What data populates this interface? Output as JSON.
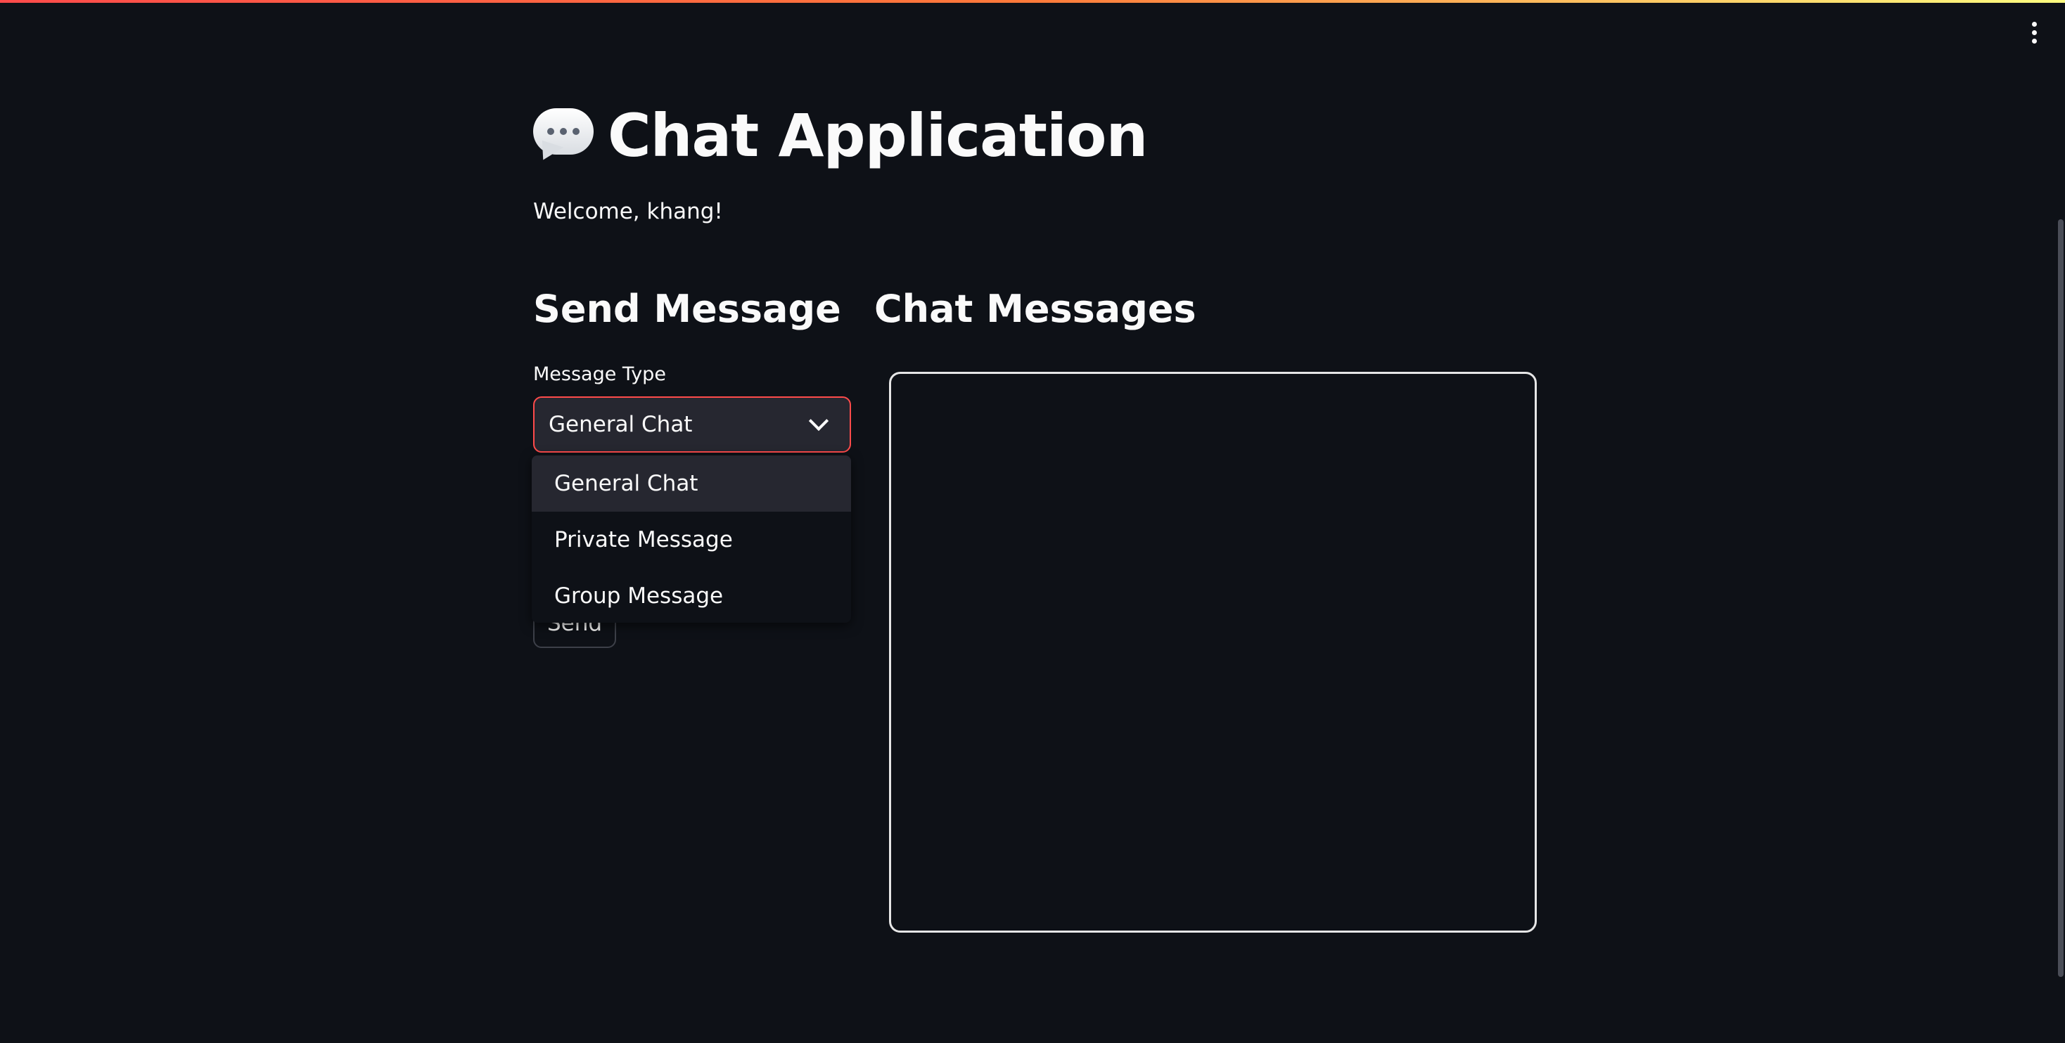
{
  "app": {
    "title": "Chat Application",
    "title_icon": "speech-bubble-icon",
    "welcome": "Welcome, khang!"
  },
  "send_section": {
    "heading": "Send Message",
    "message_type_label": "Message Type",
    "selected_type": "General Chat",
    "options": [
      "General Chat",
      "Private Message",
      "Group Message"
    ],
    "send_label": "Send"
  },
  "chat_section": {
    "heading": "Chat Messages",
    "messages": []
  },
  "colors": {
    "background": "#0e1117",
    "accent": "#ff4b4b",
    "text": "#fafafa",
    "input_bg": "#262730"
  }
}
